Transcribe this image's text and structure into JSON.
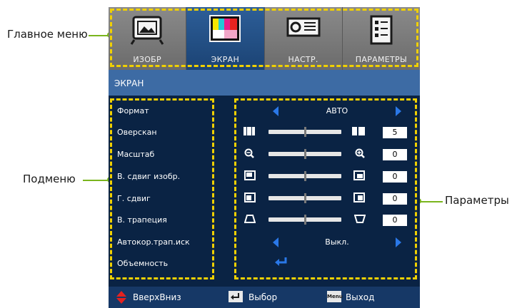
{
  "callouts": {
    "main_menu": "Главное меню",
    "submenu": "Подменю",
    "parameters": "Параметры"
  },
  "tabs": [
    {
      "label": "ИЗОБР",
      "icon": "picture-icon"
    },
    {
      "label": "ЭКРАН",
      "icon": "display-icon"
    },
    {
      "label": "НАСТР.",
      "icon": "projector-icon"
    },
    {
      "label": "ПАРАМЕТРЫ",
      "icon": "options-icon"
    }
  ],
  "header": {
    "title": "ЭКРАН"
  },
  "submenu": [
    {
      "label": "Формат"
    },
    {
      "label": "Оверскан"
    },
    {
      "label": "Масштаб"
    },
    {
      "label": "В. сдвиг изобр."
    },
    {
      "label": "Г. сдвиг"
    },
    {
      "label": "В. трапеция"
    },
    {
      "label": "Автокор.трап.иск"
    },
    {
      "label": "Объемность"
    }
  ],
  "params": {
    "format": {
      "value": "АВТО"
    },
    "overscan": {
      "value": "5",
      "level": 0.5,
      "left_icon": "overscan-minus-icon",
      "right_icon": "overscan-plus-icon"
    },
    "zoom": {
      "value": "0",
      "level": 0.5,
      "left_icon": "zoom-out-icon",
      "right_icon": "zoom-in-icon"
    },
    "v_shift": {
      "value": "0",
      "level": 0.5,
      "left_icon": "image-down-icon",
      "right_icon": "image-up-icon"
    },
    "h_shift": {
      "value": "0",
      "level": 0.5,
      "left_icon": "image-left-icon",
      "right_icon": "image-right-icon"
    },
    "keystone": {
      "value": "0",
      "level": 0.5,
      "left_icon": "keystone-narrow-top-icon",
      "right_icon": "keystone-narrow-bottom-icon"
    },
    "auto_keystone": {
      "value": "Выкл."
    }
  },
  "footer": {
    "updown": "ВверхВниз",
    "select": "Выбор",
    "exit": "Выход",
    "menu_key": "Menu"
  },
  "colors": {
    "osd_bg": "#0f2646",
    "active_tab": "#2d5e98",
    "header": "#3d6ba4",
    "highlight_dash": "#f0d000",
    "leader_line": "#7ab51d",
    "arrow": "#2a78e8"
  }
}
